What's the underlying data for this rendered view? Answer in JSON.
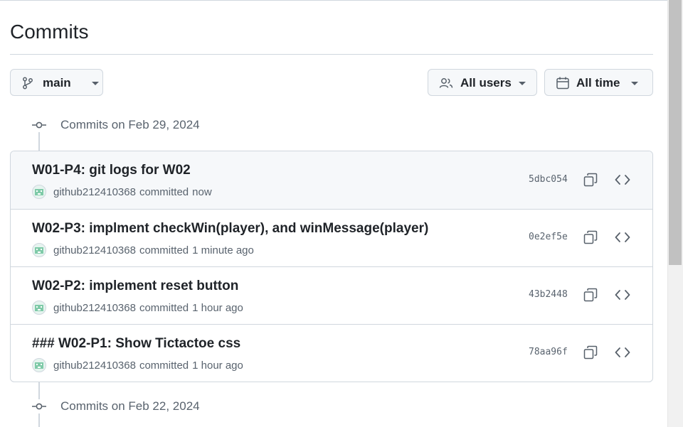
{
  "page": {
    "title": "Commits"
  },
  "filters": {
    "branch": {
      "label": "main",
      "icon": "git-branch-icon"
    },
    "users": {
      "label": "All users",
      "icon": "people-icon"
    },
    "time": {
      "label": "All time",
      "icon": "calendar-icon"
    }
  },
  "groups": [
    {
      "heading": "Commits on Feb 29, 2024",
      "commits": [
        {
          "message": "W01-P4: git logs for W02",
          "author": "github212410368",
          "committed": "committed",
          "time": "now",
          "sha": "5dbc054"
        },
        {
          "message": "W02-P3: implment checkWin(player), and winMessage(player)",
          "author": "github212410368",
          "committed": "committed",
          "time": "1 minute ago",
          "sha": "0e2ef5e"
        },
        {
          "message": "W02-P2: implement reset button",
          "author": "github212410368",
          "committed": "committed",
          "time": "1 hour ago",
          "sha": "43b2448"
        },
        {
          "message": "### W02-P1: Show Tictactoe css",
          "author": "github212410368",
          "committed": "committed",
          "time": "1 hour ago",
          "sha": "78aa96f"
        }
      ]
    },
    {
      "heading": "Commits on Feb 22, 2024",
      "commits": []
    }
  ],
  "colors": {
    "border": "#d0d7de",
    "muted_text": "#59636e",
    "hover_row": "#f6f8fa"
  }
}
